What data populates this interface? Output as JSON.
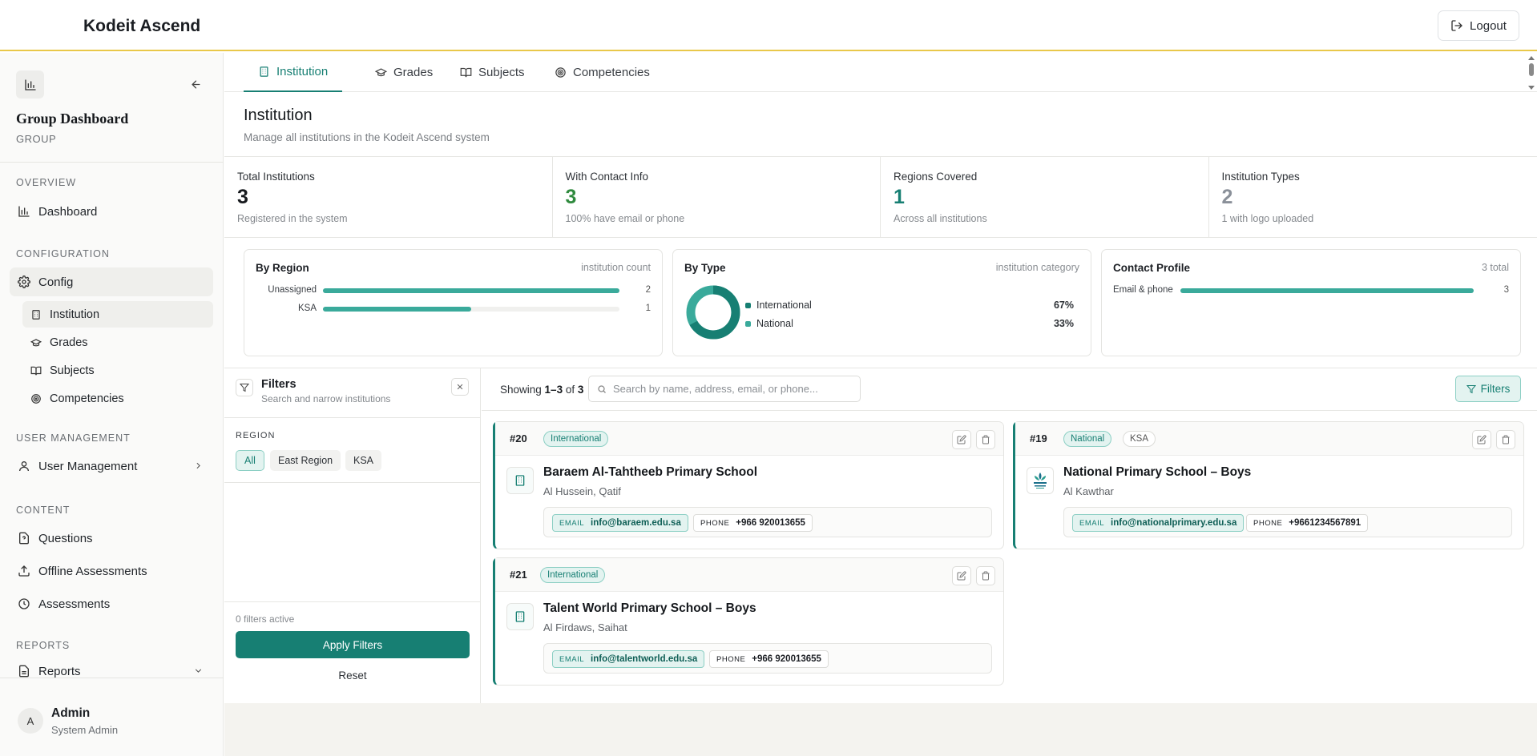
{
  "app": {
    "title": "Kodeit Ascend",
    "logout_label": "Logout"
  },
  "sidebar": {
    "title": "Group Dashboard",
    "subtitle": "GROUP",
    "sections": {
      "overview": "OVERVIEW",
      "configuration": "CONFIGURATION",
      "user_management": "USER MANAGEMENT",
      "content": "CONTENT",
      "reports": "REPORTS"
    },
    "items": {
      "dashboard": "Dashboard",
      "config": "Config",
      "institution": "Institution",
      "grades": "Grades",
      "subjects": "Subjects",
      "competencies": "Competencies",
      "user_management": "User Management",
      "questions": "Questions",
      "offline_assessments": "Offline Assessments",
      "assessments": "Assessments",
      "reports": "Reports"
    },
    "user": {
      "initial": "A",
      "name": "Admin",
      "role": "System Admin"
    }
  },
  "tabs": [
    {
      "label": "Institution",
      "icon": "building-icon",
      "active": true
    },
    {
      "label": "Grades",
      "icon": "graduation-cap-icon",
      "active": false
    },
    {
      "label": "Subjects",
      "icon": "book-icon",
      "active": false
    },
    {
      "label": "Competencies",
      "icon": "target-icon",
      "active": false
    }
  ],
  "page": {
    "title": "Institution",
    "subtitle": "Manage all institutions in the Kodeit Ascend system"
  },
  "stats": [
    {
      "label": "Total Institutions",
      "value": "3",
      "note": "Registered in the system",
      "color": "#16191d"
    },
    {
      "label": "With Contact Info",
      "value": "3",
      "note": "100% have email or phone",
      "color": "#2f8a3e"
    },
    {
      "label": "Regions Covered",
      "value": "1",
      "note": "Across all institutions",
      "color": "#177f73"
    },
    {
      "label": "Institution Types",
      "value": "2",
      "note": "1 with logo uploaded",
      "color": "#8a9099"
    }
  ],
  "by_region": {
    "title": "By Region",
    "note": "institution count",
    "rows": [
      {
        "label": "Unassigned",
        "value": 2,
        "max": 2
      },
      {
        "label": "KSA",
        "value": 1,
        "max": 2
      }
    ]
  },
  "by_type": {
    "title": "By Type",
    "note": "institution category",
    "rows": [
      {
        "label": "International",
        "pct": "67%",
        "fraction": 0.67,
        "color": "#177f73"
      },
      {
        "label": "National",
        "pct": "33%",
        "fraction": 0.33,
        "color": "#3aaa9b"
      }
    ]
  },
  "contact_profile": {
    "title": "Contact Profile",
    "note": "3 total",
    "rows": [
      {
        "label": "Email & phone",
        "value": 3,
        "max": 3
      }
    ]
  },
  "filters": {
    "title": "Filters",
    "subtitle": "Search and narrow institutions",
    "region_label": "REGION",
    "chips": [
      {
        "label": "All",
        "active": true
      },
      {
        "label": "East Region",
        "active": false
      },
      {
        "label": "KSA",
        "active": false
      }
    ],
    "active_count": "0 filters active",
    "apply_label": "Apply Filters",
    "reset_label": "Reset"
  },
  "results": {
    "showing_prefix": "Showing ",
    "range": "1–3",
    "of": " of ",
    "total": "3",
    "search_placeholder": "Search by name, address, email, or phone...",
    "filters_button": "Filters"
  },
  "institutions": [
    {
      "id": "#20",
      "type": "International",
      "region": "",
      "name": "Baraem Al-Tahtheeb Primary School",
      "location": "Al Hussein, Qatif",
      "email_key": "EMAIL",
      "email": "info@baraem.edu.sa",
      "phone_key": "PHONE",
      "phone": "+966 920013655",
      "logo": "building-icon"
    },
    {
      "id": "#19",
      "type": "National",
      "region": "KSA",
      "name": "National Primary School – Boys",
      "location": "Al Kawthar",
      "email_key": "EMAIL",
      "email": "info@nationalprimary.edu.sa",
      "phone_key": "PHONE",
      "phone": "+9661234567891",
      "logo": "school-logo"
    },
    {
      "id": "#21",
      "type": "International",
      "region": "",
      "name": "Talent World Primary School – Boys",
      "location": "Al Firdaws, Saihat",
      "email_key": "EMAIL",
      "email": "info@talentworld.edu.sa",
      "phone_key": "PHONE",
      "phone": "+966 920013655",
      "logo": "building-icon"
    }
  ]
}
